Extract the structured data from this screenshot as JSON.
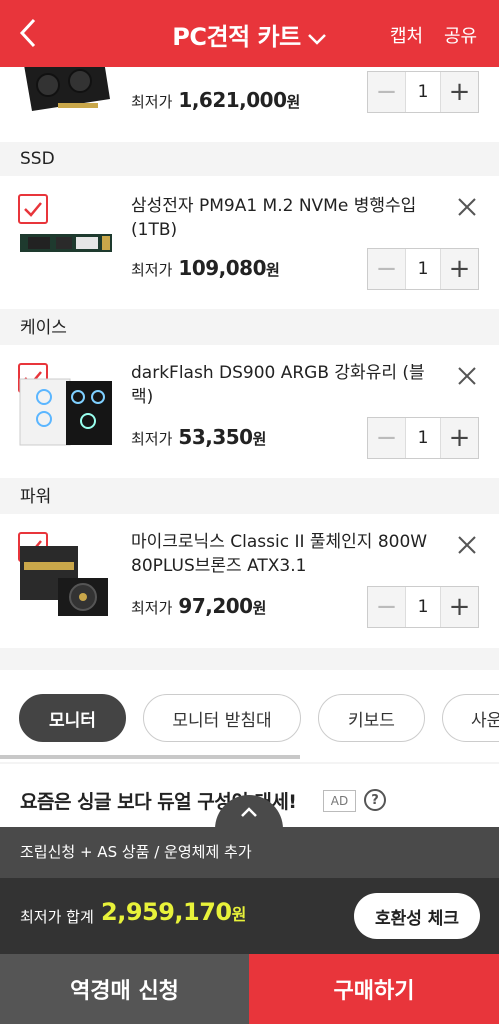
{
  "header": {
    "title": "PC견적 카트",
    "capture_label": "캡처",
    "share_label": "공유"
  },
  "items": [
    {
      "name": "",
      "price_label": "최저가",
      "price": "1,621,000",
      "won": "원",
      "qty": "1"
    },
    {
      "category": "SSD",
      "name": "삼성전자 PM9A1 M.2 NVMe 병행수입 (1TB)",
      "price_label": "최저가",
      "price": "109,080",
      "won": "원",
      "qty": "1"
    },
    {
      "category": "케이스",
      "name": "darkFlash DS900 ARGB 강화유리 (블랙)",
      "price_label": "최저가",
      "price": "53,350",
      "won": "원",
      "qty": "1"
    },
    {
      "category": "파워",
      "name": "마이크로닉스 Classic II 풀체인지 800W 80PLUS브론즈 ATX3.1",
      "price_label": "최저가",
      "price": "97,200",
      "won": "원",
      "qty": "1"
    }
  ],
  "chips": [
    "모니터",
    "모니터 받침대",
    "키보드",
    "사운"
  ],
  "promo": {
    "text": "요즘은 싱글 보다 듀얼 구성이 대세!",
    "ad": "AD",
    "help": "?"
  },
  "summary": {
    "options": "조립신청 + AS 상품 / 운영체제 추가",
    "total_label": "최저가 합계",
    "total": "2,959,170",
    "won": "원",
    "compat_label": "호환성 체크"
  },
  "footer": {
    "reverse_label": "역경매 신청",
    "buy_label": "구매하기"
  },
  "colors": {
    "accent": "#e8353b",
    "total": "#e8f23a"
  }
}
